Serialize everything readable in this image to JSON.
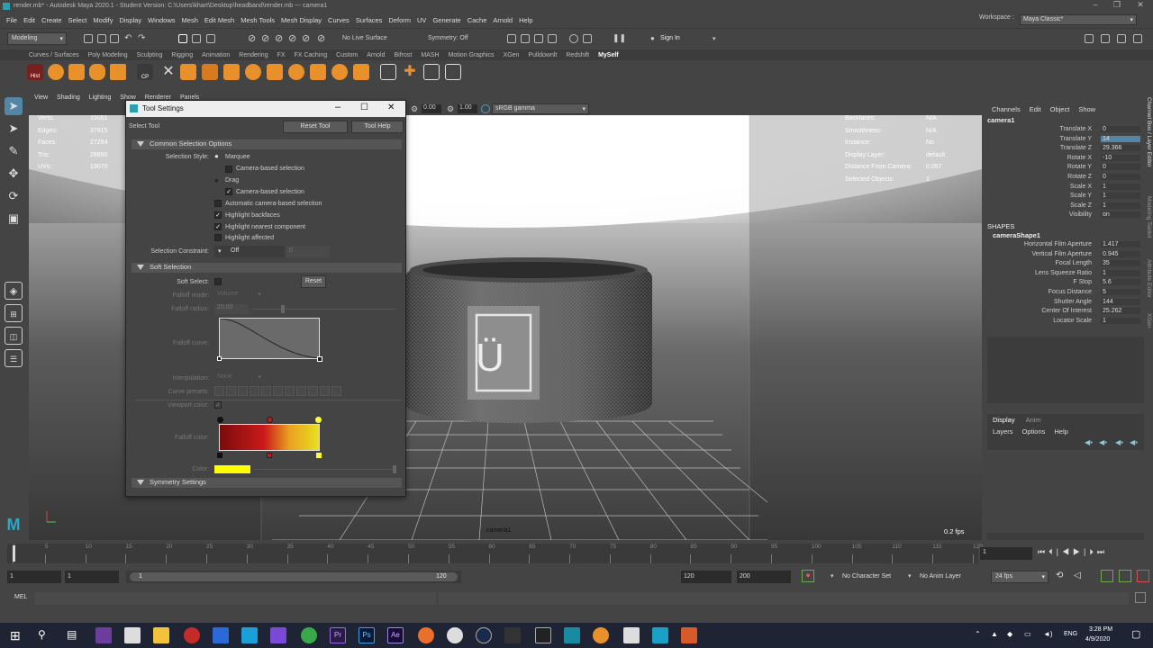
{
  "titlebar": {
    "text": "render.mb* - Autodesk Maya 2020.1 - Student Version: C:\\Users\\khart\\Desktop\\headband\\render.mb  ---  camera1"
  },
  "menubar": [
    "File",
    "Edit",
    "Create",
    "Select",
    "Modify",
    "Display",
    "Windows",
    "Mesh",
    "Edit Mesh",
    "Mesh Tools",
    "Mesh Display",
    "Curves",
    "Surfaces",
    "Deform",
    "UV",
    "Generate",
    "Cache",
    "Arnold",
    "Help"
  ],
  "workspace": {
    "label": "Workspace :",
    "value": "Maya Classic*"
  },
  "statusline": {
    "mode": "Modeling",
    "live_surface": "No Live Surface",
    "symmetry": "Symmetry: Off",
    "signin": "Sign In"
  },
  "shelf_tabs": [
    "Curves / Surfaces",
    "Poly Modeling",
    "Sculpting",
    "Rigging",
    "Animation",
    "Rendering",
    "FX",
    "FX Caching",
    "Custom",
    "Arnold",
    "Bifrost",
    "MASH",
    "Motion Graphics",
    "XGen",
    "Pulldownlt",
    "Redshift",
    "MySelf"
  ],
  "shelf_icons": {
    "hist": "Hist",
    "cp": "CP"
  },
  "viewport": {
    "menu": [
      "View",
      "Shading",
      "Lighting",
      "Show",
      "Renderer",
      "Panels"
    ],
    "bar": {
      "field1": "0.00",
      "field2": "1.00",
      "colorspace": "sRGB gamma"
    },
    "hud_left": [
      {
        "label": "Verts:",
        "value": "15051"
      },
      {
        "label": "Edges:",
        "value": "37915"
      },
      {
        "label": "Faces:",
        "value": "27294"
      },
      {
        "label": "Tris:",
        "value": "28890"
      },
      {
        "label": "UVs:",
        "value": "19070"
      }
    ],
    "hud_right": [
      {
        "label": "Backfaces:",
        "value": "N/A"
      },
      {
        "label": "Smoothness:",
        "value": "N/A"
      },
      {
        "label": "Instance:",
        "value": "No"
      },
      {
        "label": "Display Layer:",
        "value": "default"
      },
      {
        "label": "Distance From Camera:",
        "value": "0.057"
      },
      {
        "label": "Selected Objects:",
        "value": "1"
      }
    ],
    "camera_label": "camera1",
    "fps": "0.2 fps",
    "logo_glyph": "Ü"
  },
  "channelbox": {
    "tabs": [
      "Channels",
      "Edit",
      "Object",
      "Show"
    ],
    "object": "camera1",
    "attrs": [
      {
        "label": "Translate X",
        "value": "0"
      },
      {
        "label": "Translate Y",
        "value": "14"
      },
      {
        "label": "Translate Z",
        "value": "29.366"
      },
      {
        "label": "Rotate X",
        "value": "-10"
      },
      {
        "label": "Rotate Y",
        "value": "0"
      },
      {
        "label": "Rotate Z",
        "value": "0"
      },
      {
        "label": "Scale X",
        "value": "1"
      },
      {
        "label": "Scale Y",
        "value": "1"
      },
      {
        "label": "Scale Z",
        "value": "1"
      },
      {
        "label": "Visibility",
        "value": "on"
      }
    ],
    "shapes_header": "SHAPES",
    "shape_name": "cameraShape1",
    "shape_attrs": [
      {
        "label": "Horizontal Film Aperture",
        "value": "1.417"
      },
      {
        "label": "Vertical Film Aperture",
        "value": "0.945"
      },
      {
        "label": "Focal Length",
        "value": "35"
      },
      {
        "label": "Lens Squeeze Ratio",
        "value": "1"
      },
      {
        "label": "F Stop",
        "value": "5.6"
      },
      {
        "label": "Focus Distance",
        "value": "5"
      },
      {
        "label": "Shutter Angle",
        "value": "144"
      },
      {
        "label": "Center Of Interest",
        "value": "25.262"
      },
      {
        "label": "Locator Scale",
        "value": "1"
      }
    ],
    "side_tabs": [
      "Channel Box / Layer Editor",
      "Modeling Toolkit",
      "Attribute Editor",
      "XGen"
    ],
    "layers_tabs": [
      "Display",
      "Anim"
    ],
    "layers_menu": [
      "Layers",
      "Options",
      "Help"
    ]
  },
  "toolsettings": {
    "title": "Tool Settings",
    "tool_name": "Select Tool",
    "reset_tool": "Reset Tool",
    "tool_help": "Tool Help",
    "sec_common": "Common Selection Options",
    "selection_style_label": "Selection Style:",
    "marquee": "Marquee",
    "camera_based_1": "Camera-based selection",
    "drag": "Drag",
    "camera_based_2": "Camera-based selection",
    "auto_camera": "Automatic camera-based selection",
    "highlight_backfaces": "Highlight backfaces",
    "highlight_nearest": "Highlight nearest component",
    "highlight_affected": "Highlight affected",
    "constraint_label": "Selection Constraint:",
    "constraint_value": "Off",
    "constraint_num": "0",
    "sec_soft": "Soft Selection",
    "soft_select_label": "Soft Select:",
    "reset": "Reset",
    "falloff_mode_label": "Falloff mode:",
    "falloff_mode_value": "Volume",
    "falloff_radius_label": "Falloff radius:",
    "falloff_radius_value": "20.00",
    "falloff_curve_label": "Falloff curve:",
    "interpolation_label": "Interpolation:",
    "interpolation_value": "None",
    "curve_presets_label": "Curve presets:",
    "viewport_color_label": "Viewport color:",
    "falloff_color_label": "Falloff color:",
    "color_label": "Color:",
    "sec_symmetry": "Symmetry Settings",
    "gradient_colors": [
      "#7a0c0c",
      "#cc1a1a",
      "#e8a020",
      "#e8e020"
    ],
    "swatch_color": "#ffff00"
  },
  "timeline": {
    "ticks": [
      "1",
      "5",
      "10",
      "15",
      "20",
      "25",
      "30",
      "35",
      "40",
      "45",
      "50",
      "55",
      "60",
      "65",
      "70",
      "75",
      "80",
      "85",
      "90",
      "95",
      "100",
      "105",
      "110",
      "115",
      "120"
    ],
    "current": "1"
  },
  "range": {
    "start": "1",
    "inner_start": "1",
    "range_start": "1",
    "range_end": "120",
    "end": "120",
    "anim_end": "200",
    "no_character": "No Character Set",
    "no_anim_layer": "No Anim Layer",
    "fps": "24 fps"
  },
  "cmdline": {
    "label": "MEL"
  },
  "taskbar": {
    "time": "3:28 PM",
    "date": "4/9/2020",
    "lang": "ENG"
  }
}
